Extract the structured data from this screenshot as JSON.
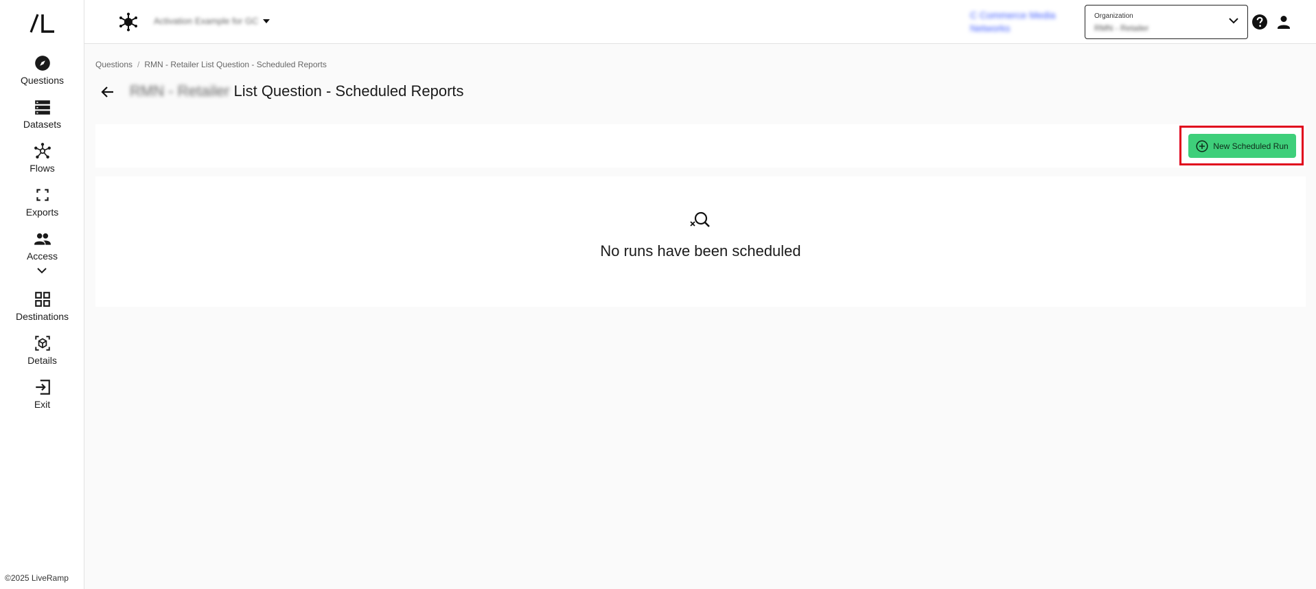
{
  "sidebar": {
    "logo": "/L",
    "items": [
      {
        "label": "Questions",
        "icon": "compass-icon"
      },
      {
        "label": "Datasets",
        "icon": "database-icon"
      },
      {
        "label": "Flows",
        "icon": "flows-icon"
      },
      {
        "label": "Exports",
        "icon": "exports-icon"
      },
      {
        "label": "Access",
        "icon": "people-icon"
      },
      {
        "label": "Destinations",
        "icon": "grid-icon"
      },
      {
        "label": "Details",
        "icon": "cube-icon"
      },
      {
        "label": "Exit",
        "icon": "exit-icon"
      }
    ],
    "copyright": "©2025 LiveRamp"
  },
  "topbar": {
    "workspace_name": "Activation Example for GC",
    "org_link": "C Commerce Media Networks",
    "org_select_label": "Organization",
    "org_select_value": "RMN - Retailer"
  },
  "breadcrumb": {
    "root": "Questions",
    "separator": "/",
    "current": "RMN - Retailer List Question - Scheduled Reports"
  },
  "page": {
    "title_prefix": "RMN - Retailer",
    "title_main": "List Question - Scheduled Reports"
  },
  "toolbar": {
    "new_run_label": "New Scheduled Run"
  },
  "empty_state": {
    "message": "No runs have been scheduled"
  },
  "colors": {
    "accent_green": "#3ecf7a",
    "highlight_red": "#e0001b",
    "link_blue": "#3d5afe"
  }
}
